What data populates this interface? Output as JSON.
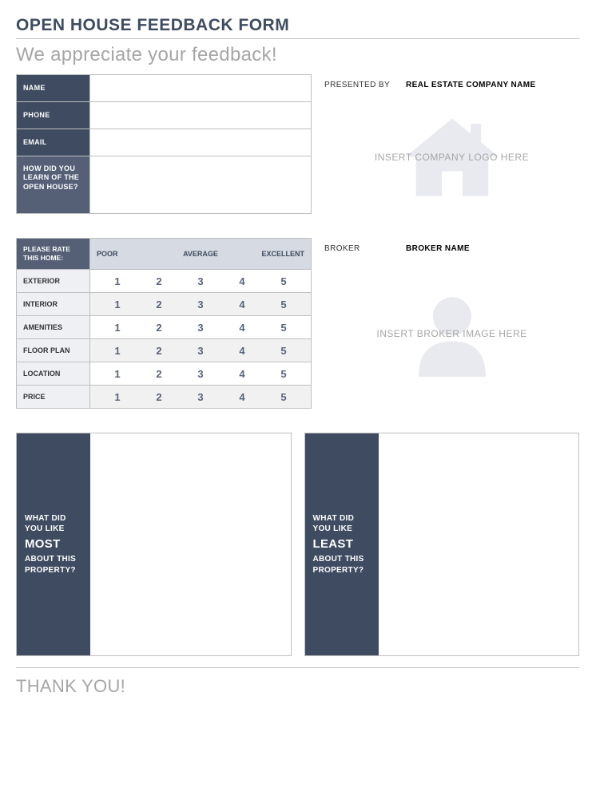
{
  "title": "OPEN HOUSE FEEDBACK FORM",
  "appreciate": "We appreciate your feedback!",
  "contact": {
    "name_label": "NAME",
    "phone_label": "PHONE",
    "email_label": "EMAIL",
    "how_label": "HOW DID YOU LEARN OF THE OPEN HOUSE?",
    "name_value": "",
    "phone_value": "",
    "email_value": "",
    "how_value": ""
  },
  "company": {
    "presented_by_label": "PRESENTED BY",
    "presented_by_value": "REAL ESTATE COMPANY NAME",
    "logo_placeholder": "INSERT COMPANY LOGO HERE"
  },
  "broker": {
    "label": "BROKER",
    "value": "BROKER NAME",
    "image_placeholder": "INSERT BROKER IMAGE HERE"
  },
  "rating": {
    "header": "PLEASE RATE THIS HOME:",
    "scale": {
      "low": "POOR",
      "mid": "AVERAGE",
      "high": "EXCELLENT"
    },
    "numbers": [
      "1",
      "2",
      "3",
      "4",
      "5"
    ],
    "rows": [
      {
        "label": "EXTERIOR"
      },
      {
        "label": "INTERIOR"
      },
      {
        "label": "AMENITIES"
      },
      {
        "label": "FLOOR PLAN"
      },
      {
        "label": "LOCATION"
      },
      {
        "label": "PRICE"
      }
    ]
  },
  "freeform": {
    "most_line1": "WHAT DID",
    "most_line2": "YOU LIKE",
    "most_big": "MOST",
    "most_line3": "ABOUT THIS",
    "most_line4": "PROPERTY?",
    "least_line1": "WHAT DID",
    "least_line2": "YOU LIKE",
    "least_big": "LEAST",
    "least_line3": "ABOUT THIS",
    "least_line4": "PROPERTY?"
  },
  "thank_you": "THANK YOU!"
}
